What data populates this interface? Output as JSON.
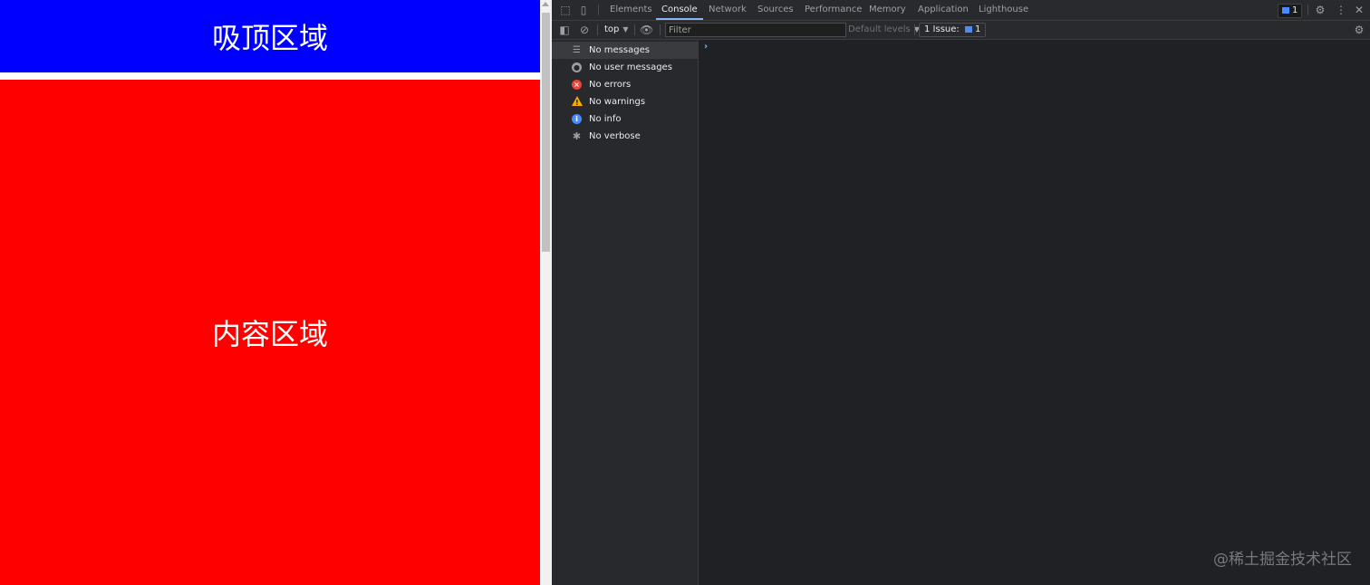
{
  "page": {
    "sticky_text": "吸顶区域",
    "content_text": "内容区域",
    "colors": {
      "sticky_bg": "#0000ff",
      "content_bg": "#ff0000"
    }
  },
  "devtools": {
    "tabs": [
      "Elements",
      "Console",
      "Network",
      "Sources",
      "Performance",
      "Memory",
      "Application",
      "Lighthouse"
    ],
    "active_tab": "Console",
    "message_badge": "1",
    "toolbar": {
      "context": "top",
      "filter_placeholder": "Filter",
      "levels": "Default levels",
      "issues_label": "1 Issue:",
      "issues_count": "1"
    },
    "sidebar": [
      {
        "label": "No messages",
        "icon": "list-icon"
      },
      {
        "label": "No user messages",
        "icon": "user-icon"
      },
      {
        "label": "No errors",
        "icon": "error-icon"
      },
      {
        "label": "No warnings",
        "icon": "warning-icon"
      },
      {
        "label": "No info",
        "icon": "info-icon"
      },
      {
        "label": "No verbose",
        "icon": "bug-icon"
      }
    ],
    "prompt": "›"
  },
  "watermark": "@稀土掘金技术社区"
}
